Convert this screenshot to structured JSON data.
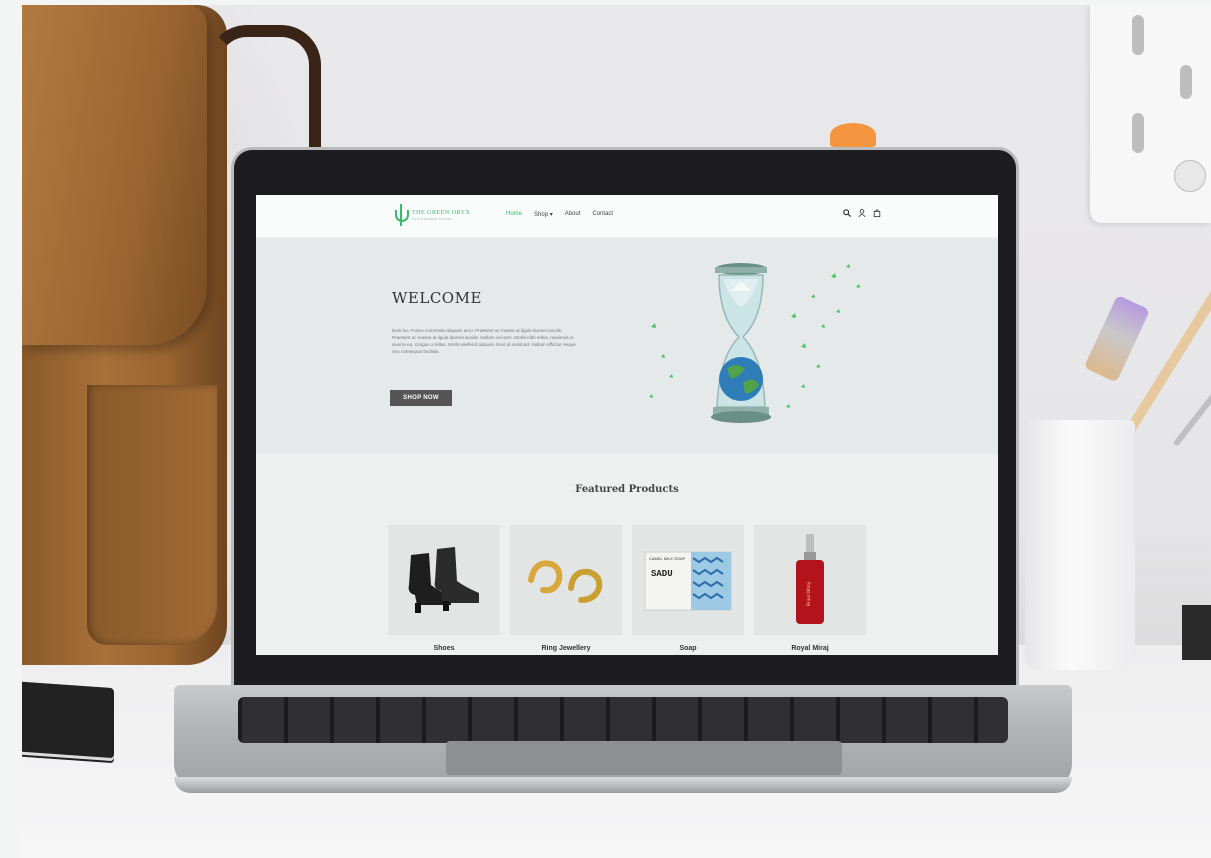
{
  "nav": {
    "logo_text": "THE GREEN ORYX",
    "logo_sub": "SUSTAINABLE LIVING",
    "menu": [
      "Home",
      "Shop ▾",
      "About",
      "Contact"
    ],
    "icons": [
      "search-icon",
      "user-icon",
      "bag-icon"
    ]
  },
  "hero": {
    "title": "WELCOME",
    "body": "Duis leo. Fusce commodo aliquam arcu. Praesent ac massa at ligula laoreet iaculis. Praesent ac massa at ligula laoreet iaculis. Nullam vel sem. Morbi nibh tellus, maximus in viverra eu, congue a tellus. Morbi eleifend aliquam risus id euismod. Nullam efficitur neque non consequat facilisis.",
    "button": "SHOP NOW"
  },
  "featured": {
    "title": "Featured Products",
    "products": [
      {
        "name": "Shoes",
        "icon": "boots-image"
      },
      {
        "name": "Ring Jewellery",
        "icon": "earrings-image"
      },
      {
        "name": "Soap",
        "icon": "soap-box-image",
        "box_text": "CAMEL MILK SOAP",
        "brand": "SADU"
      },
      {
        "name": "Royal Miraj",
        "icon": "perfume-bottle-image",
        "bottle_text": "Royal Miraj"
      }
    ]
  },
  "colors": {
    "accent": "#3bb86a",
    "button": "#555555",
    "hero_bg": "#e6e9e9"
  }
}
